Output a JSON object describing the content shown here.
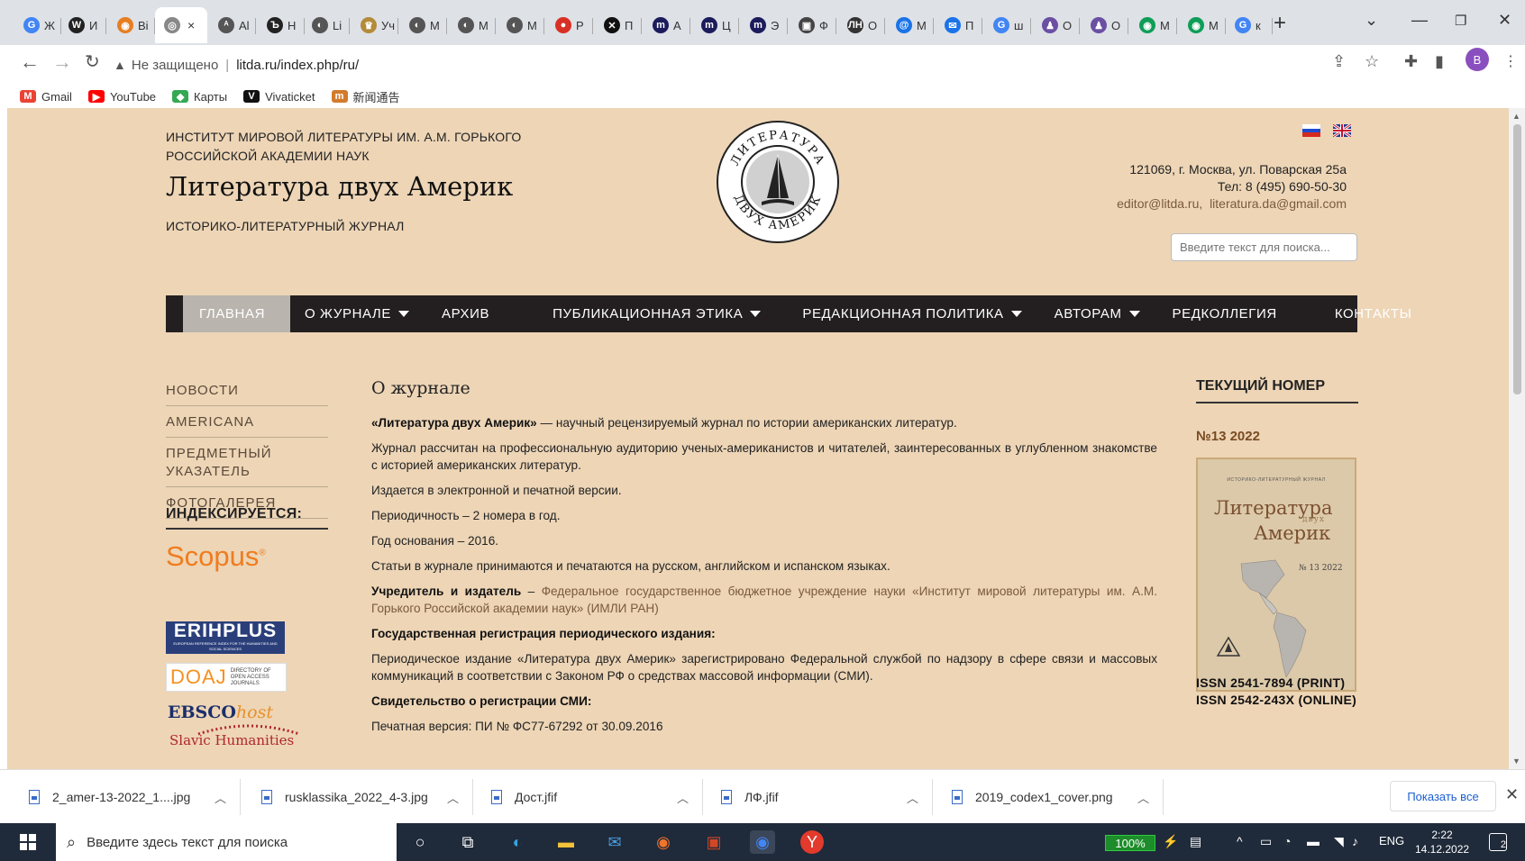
{
  "browser": {
    "tabs": [
      {
        "icon": "google-icon",
        "short": "Ж",
        "color": "#4285f4",
        "glyph": "G"
      },
      {
        "icon": "wikipedia-icon",
        "short": "И",
        "color": "#222222",
        "glyph": "W"
      },
      {
        "icon": "orange-site-icon",
        "short": "Bi",
        "color": "#e67e22",
        "glyph": "◉"
      },
      {
        "icon": "litda-icon",
        "short": "×",
        "color": "#888888",
        "glyph": "◎",
        "active": true
      },
      {
        "icon": "aia-icon",
        "short": "Al",
        "color": "#555555",
        "glyph": "ᴬ"
      },
      {
        "icon": "b-icon",
        "short": "Н",
        "color": "#222222",
        "glyph": "Ъ"
      },
      {
        "icon": "globe-icon",
        "short": "Li",
        "color": "#555555",
        "glyph": "◐"
      },
      {
        "icon": "coat-of-arms-icon",
        "short": "Уч",
        "color": "#b38b3a",
        "glyph": "♛"
      },
      {
        "icon": "globe-icon",
        "short": "М",
        "color": "#555555",
        "glyph": "◐"
      },
      {
        "icon": "globe-icon",
        "short": "М",
        "color": "#555555",
        "glyph": "◐"
      },
      {
        "icon": "globe-icon",
        "short": "М",
        "color": "#555555",
        "glyph": "◐"
      },
      {
        "icon": "red-circle-icon",
        "short": "Р",
        "color": "#d93025",
        "glyph": "●"
      },
      {
        "icon": "x-icon",
        "short": "П",
        "color": "#111111",
        "glyph": "✕"
      },
      {
        "icon": "mm-icon",
        "short": "А",
        "color": "#1c1c5c",
        "glyph": "m"
      },
      {
        "icon": "mm-icon",
        "short": "Ц",
        "color": "#1c1c5c",
        "glyph": "m"
      },
      {
        "icon": "mm-icon",
        "short": "Э",
        "color": "#1c1c5c",
        "glyph": "m"
      },
      {
        "icon": "square-icon",
        "short": "Ф",
        "color": "#444444",
        "glyph": "▣"
      },
      {
        "icon": "lhc-icon",
        "short": "О",
        "color": "#333333",
        "glyph": "ЛН"
      },
      {
        "icon": "at-icon",
        "short": "М",
        "color": "#1a73e8",
        "glyph": "@"
      },
      {
        "icon": "mail-icon",
        "short": "П",
        "color": "#1a73e8",
        "glyph": "✉"
      },
      {
        "icon": "google-icon",
        "short": "ш",
        "color": "#4285f4",
        "glyph": "G"
      },
      {
        "icon": "person-icon",
        "short": "О",
        "color": "#6a4fa3",
        "glyph": "♟"
      },
      {
        "icon": "person-icon",
        "short": "О",
        "color": "#6a4fa3",
        "glyph": "♟"
      },
      {
        "icon": "green-icon",
        "short": "М",
        "color": "#0f9d58",
        "glyph": "◉"
      },
      {
        "icon": "green-icon",
        "short": "М",
        "color": "#0f9d58",
        "glyph": "◉"
      },
      {
        "icon": "google-icon",
        "short": "к",
        "color": "#4285f4",
        "glyph": "G"
      }
    ],
    "security_label": "Не защищено",
    "url": "litda.ru/index.php/ru/",
    "profile_initial": "B",
    "bookmarks": [
      {
        "label": "Gmail",
        "icon": "gmail-icon",
        "color": "#ea4335",
        "glyph": "M"
      },
      {
        "label": "YouTube",
        "icon": "youtube-icon",
        "color": "#ff0000",
        "glyph": "▶"
      },
      {
        "label": "Карты",
        "icon": "maps-icon",
        "color": "#34a853",
        "glyph": "◆"
      },
      {
        "label": "Vivaticket",
        "icon": "vivaticket-icon",
        "color": "#111111",
        "glyph": "V"
      },
      {
        "label": "新闻通告",
        "icon": "news-icon",
        "color": "#d27b2c",
        "glyph": "m"
      }
    ]
  },
  "header": {
    "institute_line1": "ИНСТИТУТ МИРОВОЙ ЛИТЕРАТУРЫ ИМ. А.М. ГОРЬКОГО",
    "institute_line2": "РОССИЙСКОЙ АКАДЕМИИ НАУК",
    "title": "Литература двух Америк",
    "subtitle": "ИСТОРИКО-ЛИТЕРАТУРНЫЙ ЖУРНАЛ",
    "logo_top": "ЛИТЕРАТУРА",
    "logo_bottom": "ДВУХ АМЕРИК",
    "address": "121069, г. Москва, ул. Поварская 25а",
    "phone": "Тел: 8 (495) 690-50-30",
    "email1": "editor@litda.ru",
    "email2": "literatura.da@gmail.com",
    "search_placeholder": "Введите текст для поиска..."
  },
  "nav": {
    "items": [
      {
        "label": "ГЛАВНАЯ",
        "active": true,
        "dropdown": false
      },
      {
        "label": "О ЖУРНАЛЕ",
        "dropdown": true
      },
      {
        "label": "АРХИВ",
        "dropdown": false
      },
      {
        "label": "ПУБЛИКАЦИОННАЯ ЭТИКА",
        "dropdown": true
      },
      {
        "label": "РЕДАКЦИОННАЯ ПОЛИТИКА",
        "dropdown": true
      },
      {
        "label": "АВТОРАМ",
        "dropdown": true
      },
      {
        "label": "РЕДКОЛЛЕГИЯ",
        "dropdown": false
      },
      {
        "label": "КОНТАКТЫ",
        "dropdown": false
      }
    ]
  },
  "sidebar": {
    "items": [
      "НОВОСТИ",
      "AMERICANA",
      "ПРЕДМЕТНЫЙ УКАЗАТЕЛЬ",
      "ФОТОГАЛЕРЕЯ"
    ],
    "indexed_title": "ИНДЕКСИРУЕТСЯ:",
    "scopus": "Scopus",
    "erihplus": "ERIHPLUS",
    "erihplus_sub": "EUROPEAN REFERENCE INDEX FOR THE HUMANITIES AND SOCIAL SCIENCES",
    "doaj": "DOAJ",
    "doaj_sub": "DIRECTORY OF OPEN ACCESS JOURNALS",
    "ebsco": "EBSCO",
    "ebsco_host": "host",
    "slavic": "Slavic Humanities"
  },
  "content": {
    "title": "О журнале",
    "p1_bold": "«Литература двух Америк»",
    "p1_rest": " — научный рецензируемый журнал по истории американских литератур.",
    "p2": "Журнал рассчитан на профессиональную аудиторию ученых-американистов и читателей, заинтересованных в углубленном знакомстве с историей американских литератур.",
    "p3": "Издается в электронной и печатной версии.",
    "p4": "Периодичность – 2 номера в год.",
    "p5": "Год основания – 2016.",
    "p6": "Статьи в журнале принимаются и печатаются на русском, английском и испанском языках.",
    "p7_bold": "Учредитель и издатель",
    "p7_dash": " – ",
    "p7_link": "Федеральное государственное бюджетное учреждение науки «Институт мировой литературы им. А.М. Горького Российской академии наук» (ИМЛИ РАН)",
    "p8_bold": "Государственная регистрация периодического издания:",
    "p9": "Периодическое издание «Литература двух Америк» зарегистрировано Федеральной службой по надзору в сфере связи и массовых коммуникаций в соответствии с Законом РФ о средствах массовой информации (СМИ).",
    "p10_bold": "Свидетельство о регистрации СМИ:",
    "p11": "Печатная версия: ПИ № ФС77-67292 от 30.09.2016"
  },
  "issue": {
    "head": "ТЕКУЩИЙ НОМЕР",
    "number": "№13 2022",
    "cover_top": "ИСТОРИКО-ЛИТЕРАТУРНЫЙ ЖУРНАЛ",
    "cover_title1": "Литература",
    "cover_dvuh": "двух",
    "cover_title2": "Америк",
    "cover_num": "№ 13 2022",
    "issn_print": "ISSN 2541-7894  (PRINT)",
    "issn_online": "ISSN 2542-243X (ONLINE)"
  },
  "downloads": {
    "files": [
      "2_amer-13-2022_1....jpg",
      "rusklassika_2022_4-3.jpg",
      "Дост.jfif",
      "ЛФ.jfif",
      "2019_codex1_cover.png"
    ],
    "show_all": "Показать все"
  },
  "taskbar": {
    "search_placeholder": "Введите здесь текст для поиска",
    "battery": "100%",
    "lang": "ENG",
    "time": "2:22",
    "date": "14.12.2022",
    "notifications": "2"
  }
}
